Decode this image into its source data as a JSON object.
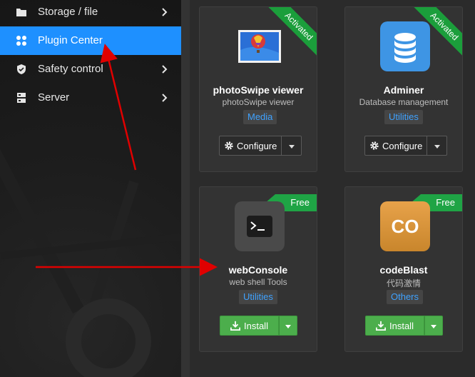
{
  "sidebar": {
    "items": [
      {
        "label": "Storage / file",
        "icon": "folder-icon",
        "has_arrow": true,
        "active": false
      },
      {
        "label": "Plugin Center",
        "icon": "plugin-icon",
        "has_arrow": false,
        "active": true
      },
      {
        "label": "Safety control",
        "icon": "shield-icon",
        "has_arrow": true,
        "active": false
      },
      {
        "label": "Server",
        "icon": "server-icon",
        "has_arrow": true,
        "active": false
      }
    ]
  },
  "plugins": [
    {
      "title": "photoSwipe viewer",
      "description": "photoSwipe viewer",
      "tag": "Media",
      "status": "Activated",
      "action": "Configure",
      "icon": "balloon-image-icon"
    },
    {
      "title": "Adminer",
      "description": "Database management",
      "tag": "Utilities",
      "status": "Activated",
      "action": "Configure",
      "icon": "database-icon"
    },
    {
      "title": "webConsole",
      "description": "web shell Tools",
      "tag": "Utilities",
      "status": "Free",
      "action": "Install",
      "icon": "terminal-icon"
    },
    {
      "title": "codeBlast",
      "description": "代码激情",
      "tag": "Others",
      "status": "Free",
      "action": "Install",
      "icon": "co-logo-icon",
      "icon_text": "CO"
    }
  ],
  "colors": {
    "accent": "#1e90ff",
    "activated_ribbon": "#1b9e3b",
    "free_ribbon": "#1fa445",
    "install_button": "#4cae4c",
    "tag_text": "#3fa2ff",
    "annotation_arrow": "#e00000"
  }
}
